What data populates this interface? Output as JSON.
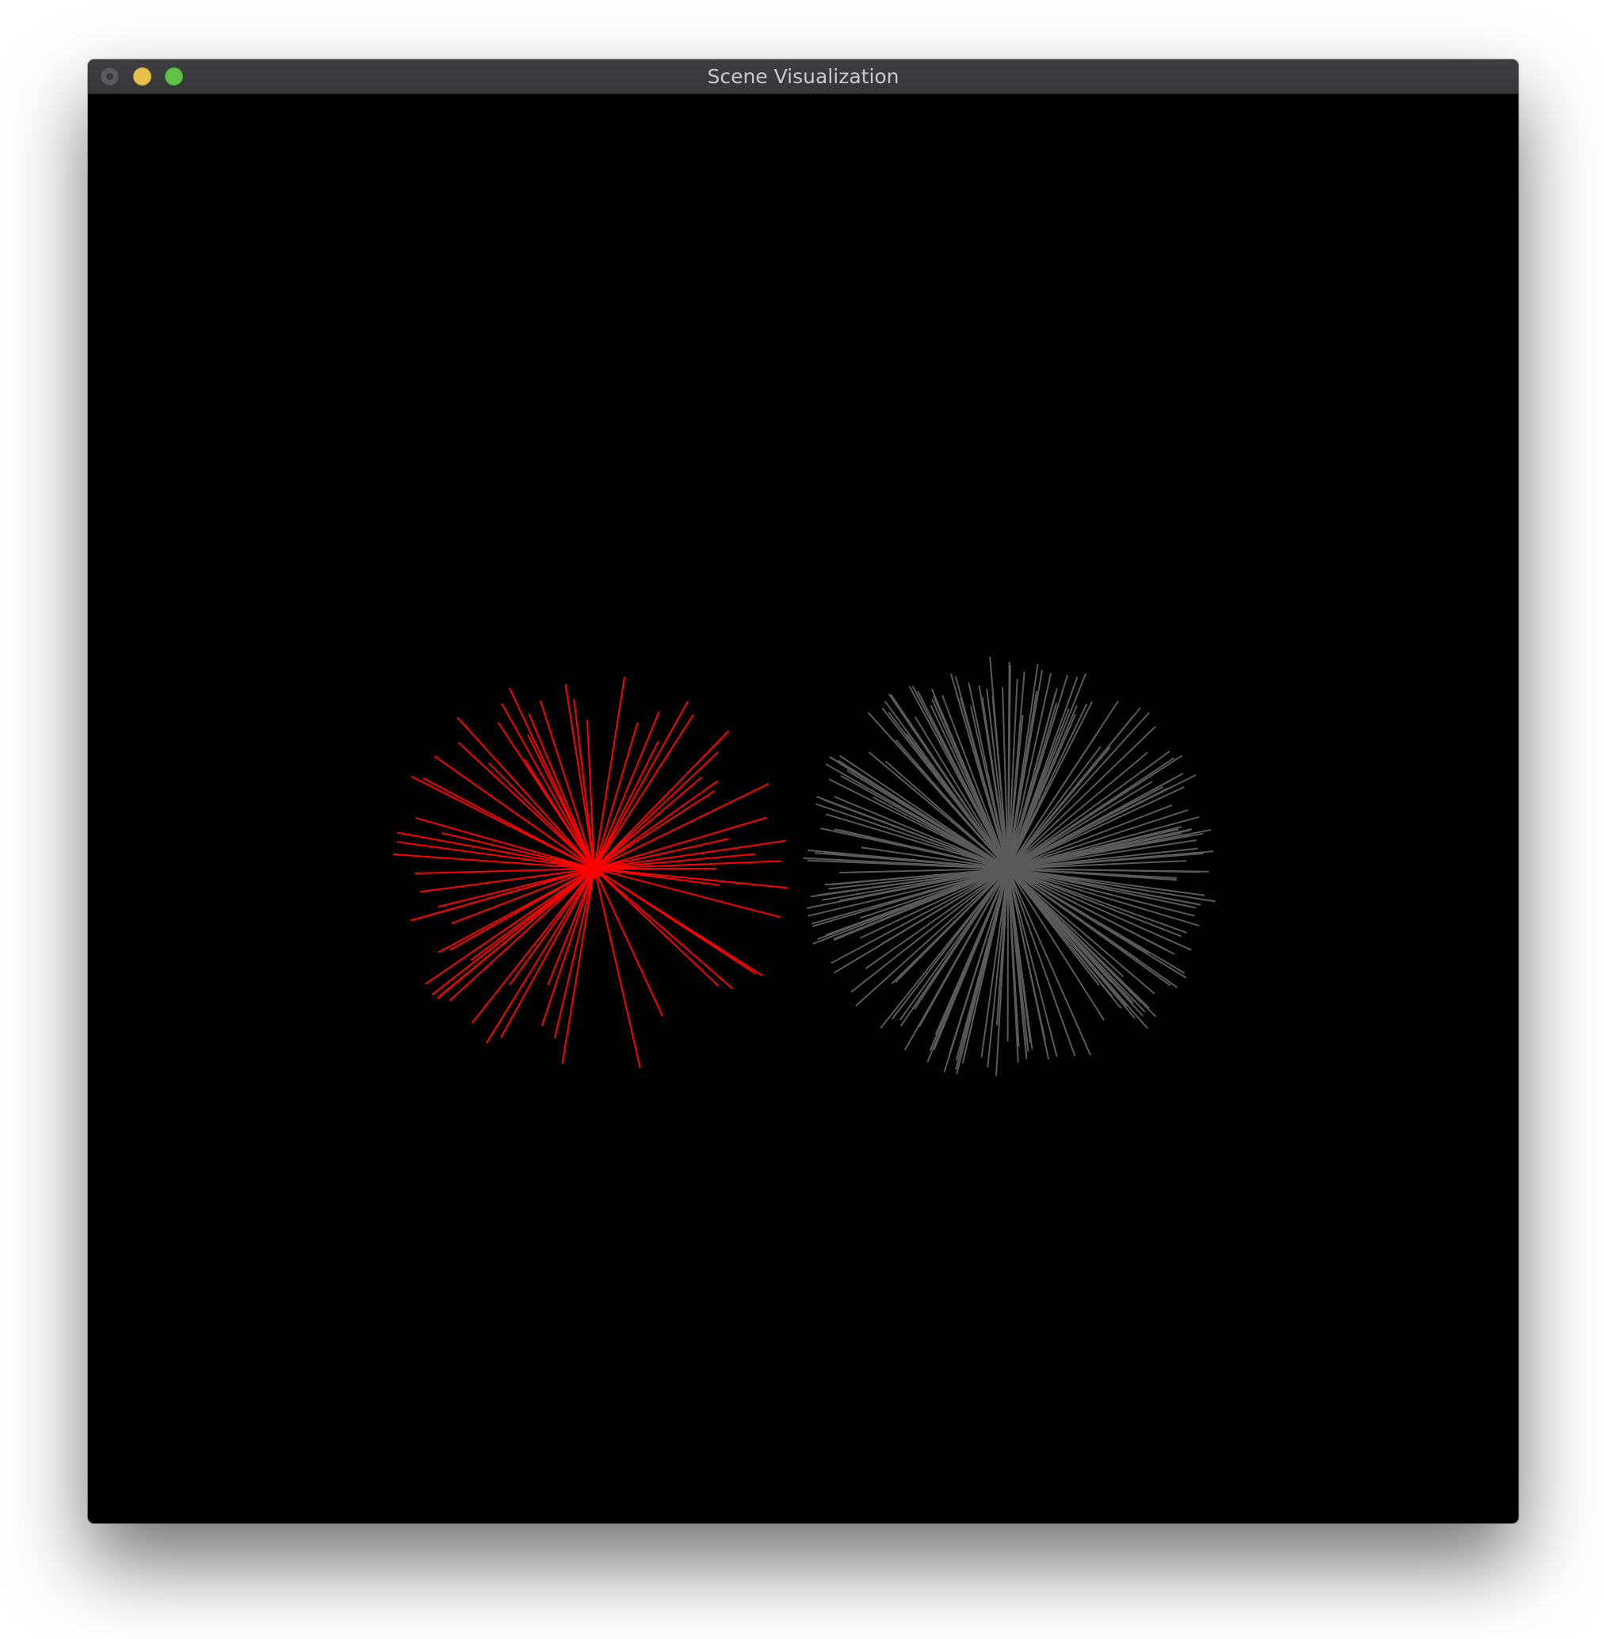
{
  "window": {
    "title": "Scene Visualization",
    "controls": {
      "close": "close-button",
      "minimize": "minimize-button",
      "zoom": "zoom-button"
    }
  },
  "scene": {
    "background": "#000000",
    "objects": [
      {
        "name": "red-ray-burst",
        "color": "#ff0000"
      },
      {
        "name": "gray-ray-burst",
        "color": "#5a5a5a"
      }
    ]
  }
}
